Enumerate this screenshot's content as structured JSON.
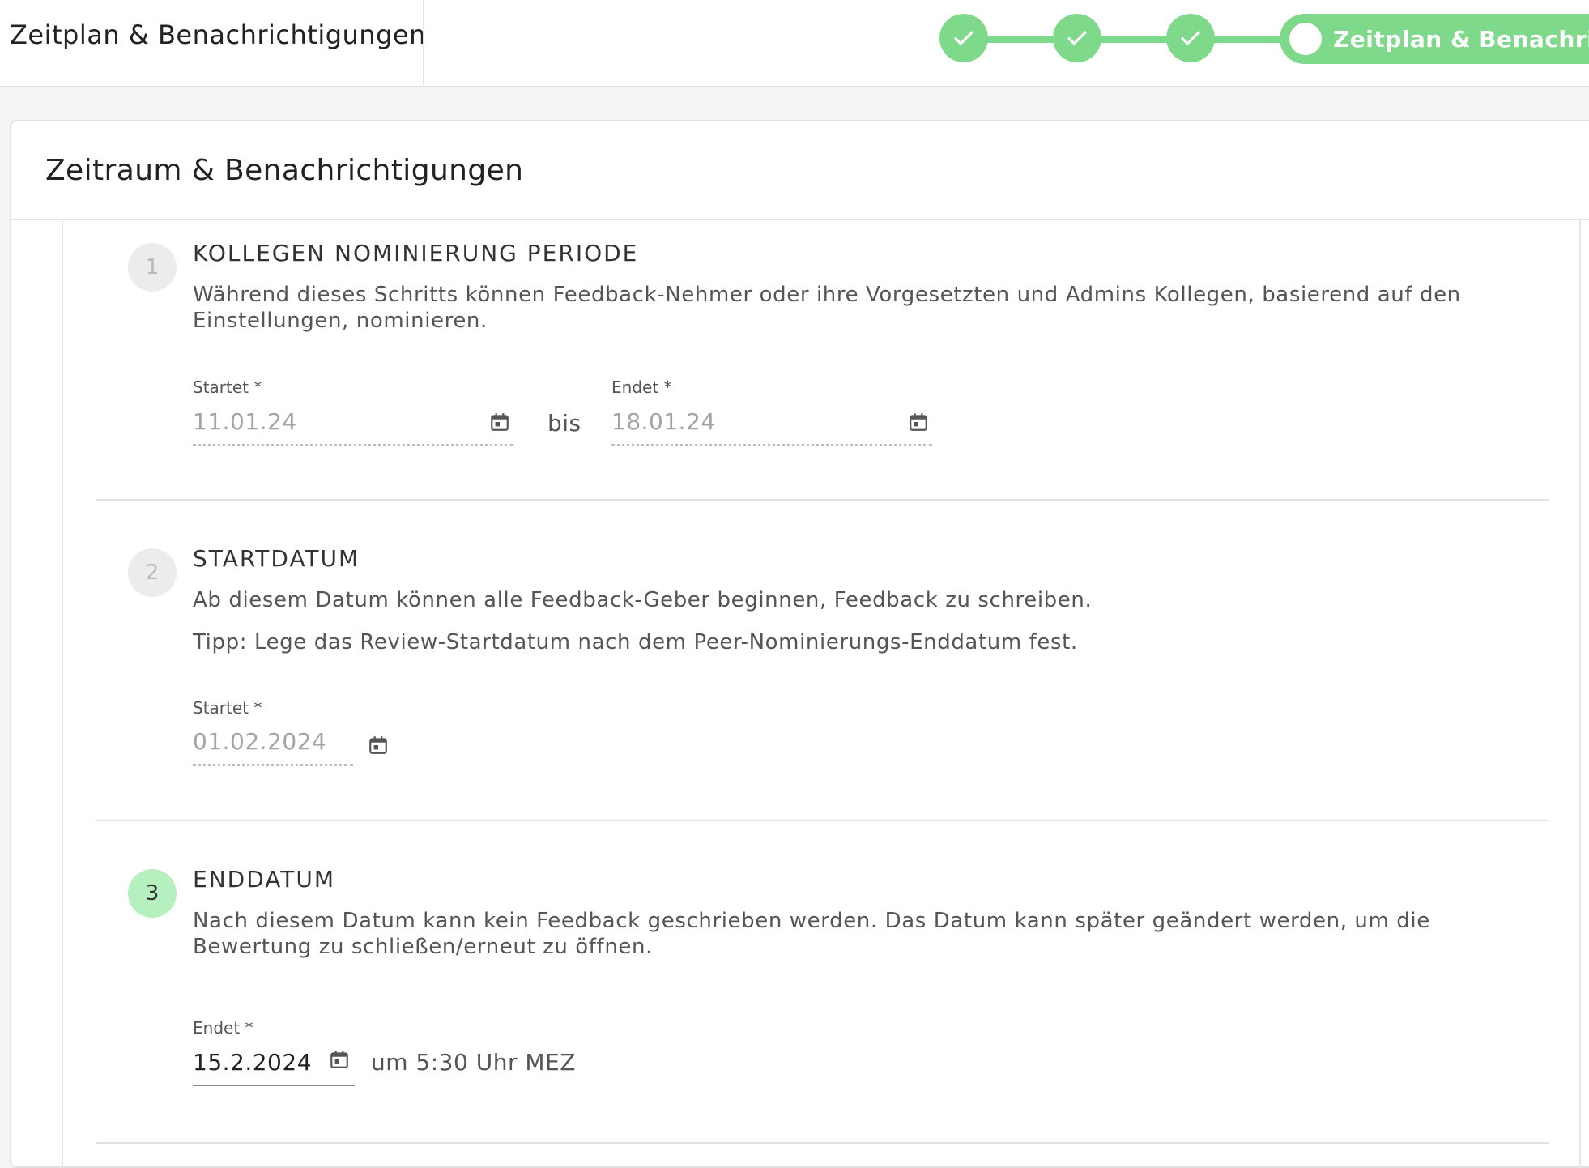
{
  "header": {
    "title": "Zeitplan & Benachrichtigungen",
    "active_step_label": "Zeitplan & Benachrichtigungen"
  },
  "card": {
    "title": "Zeitraum & Benachrichtigungen"
  },
  "sections": [
    {
      "number": "1",
      "title": "KOLLEGEN NOMINIERUNG PERIODE",
      "description": "Während dieses Schritts können Feedback-Nehmer oder ihre Vorgesetzten und Admins Kollegen, basierend auf den Einstellungen, nominieren.",
      "start_label": "Startet *",
      "start_value": "11.01.24",
      "between": "bis",
      "end_label": "Endet *",
      "end_value": "18.01.24"
    },
    {
      "number": "2",
      "title": "STARTDATUM",
      "description": "Ab diesem Datum können alle Feedback-Geber beginnen, Feedback zu schreiben.",
      "tip": "Tipp: Lege das Review-Startdatum nach dem Peer-Nominierungs-Enddatum fest.",
      "start_label": "Startet *",
      "start_value": "01.02.2024"
    },
    {
      "number": "3",
      "title": "ENDDATUM",
      "description": "Nach diesem Datum kann kein Feedback geschrieben werden. Das Datum kann später geändert werden, um die Bewertung zu schließen/erneut zu öffnen.",
      "end_label": "Endet *",
      "end_value": "15.2.2024",
      "time_text": "um 5:30 Uhr MEZ"
    }
  ],
  "colors": {
    "accent": "#7ed98a",
    "active_number_bg": "#b7f0bf"
  }
}
